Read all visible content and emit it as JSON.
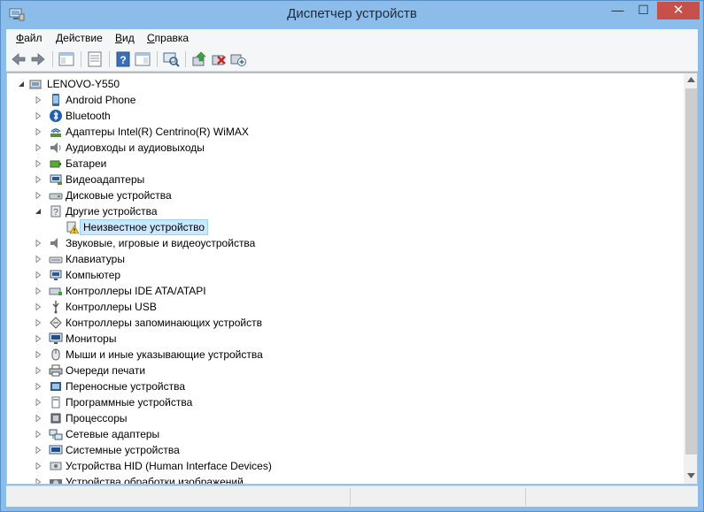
{
  "window": {
    "title": "Диспетчер устройств",
    "close_glyph": "✕",
    "minimize_glyph": "—",
    "maximize_glyph": "☐",
    "title_icon": "device-manager-icon"
  },
  "menu": [
    {
      "label_u": "Ф",
      "label_rest": "айл"
    },
    {
      "label_u": "Д",
      "label_rest": "ействие"
    },
    {
      "label_u": "В",
      "label_rest": "ид"
    },
    {
      "label_u": "С",
      "label_rest": "правка"
    }
  ],
  "toolbar": {
    "buttons": [
      "back-arrow-icon",
      "forward-arrow-icon",
      "show-hide-console-tree-icon",
      "properties-icon",
      "help-icon",
      "action-pane-icon",
      "scan-hardware-icon",
      "update-driver-icon",
      "uninstall-device-icon",
      "add-legacy-hardware-icon"
    ]
  },
  "tree": {
    "root": "LENOVO-Y550",
    "items": [
      {
        "label": "Android Phone",
        "icon": "android-phone-icon",
        "expanded": false
      },
      {
        "label": "Bluetooth",
        "icon": "bluetooth-icon",
        "expanded": false
      },
      {
        "label": "Адаптеры Intel(R) Centrino(R) WiMAX",
        "icon": "wimax-icon",
        "expanded": false
      },
      {
        "label": "Аудиовходы и аудиовыходы",
        "icon": "speaker-icon",
        "expanded": false
      },
      {
        "label": "Батареи",
        "icon": "battery-icon",
        "expanded": false
      },
      {
        "label": "Видеоадаптеры",
        "icon": "display-adapter-icon",
        "expanded": false
      },
      {
        "label": "Дисковые устройства",
        "icon": "disk-drive-icon",
        "expanded": false
      },
      {
        "label": "Другие устройства",
        "icon": "other-devices-icon",
        "expanded": true
      },
      {
        "label": "Неизвестное устройство",
        "icon": "unknown-device-warning-icon",
        "child": true,
        "selected": true
      },
      {
        "label": "Звуковые, игровые и видеоустройства",
        "icon": "sound-icon",
        "expanded": false
      },
      {
        "label": "Клавиатуры",
        "icon": "keyboard-icon",
        "expanded": false
      },
      {
        "label": "Компьютер",
        "icon": "computer-icon",
        "expanded": false
      },
      {
        "label": "Контроллеры IDE ATA/ATAPI",
        "icon": "ide-controller-icon",
        "expanded": false
      },
      {
        "label": "Контроллеры USB",
        "icon": "usb-icon",
        "expanded": false
      },
      {
        "label": "Контроллеры запоминающих устройств",
        "icon": "storage-controller-icon",
        "expanded": false
      },
      {
        "label": "Мониторы",
        "icon": "monitor-icon",
        "expanded": false
      },
      {
        "label": "Мыши и иные указывающие устройства",
        "icon": "mouse-icon",
        "expanded": false
      },
      {
        "label": "Очереди печати",
        "icon": "printer-icon",
        "expanded": false
      },
      {
        "label": "Переносные устройства",
        "icon": "portable-device-icon",
        "expanded": false
      },
      {
        "label": "Программные устройства",
        "icon": "software-device-icon",
        "expanded": false
      },
      {
        "label": "Процессоры",
        "icon": "processor-icon",
        "expanded": false
      },
      {
        "label": "Сетевые адаптеры",
        "icon": "network-adapter-icon",
        "expanded": false
      },
      {
        "label": "Системные устройства",
        "icon": "system-device-icon",
        "expanded": false
      },
      {
        "label": "Устройства HID (Human Interface Devices)",
        "icon": "hid-icon",
        "expanded": false
      },
      {
        "label": "Устройства обработки изображений",
        "icon": "imaging-device-icon",
        "expanded": false
      }
    ]
  },
  "colors": {
    "title_bar": "#8cbcea",
    "close_button": "#c7504a",
    "selection": "#cce8ff"
  }
}
